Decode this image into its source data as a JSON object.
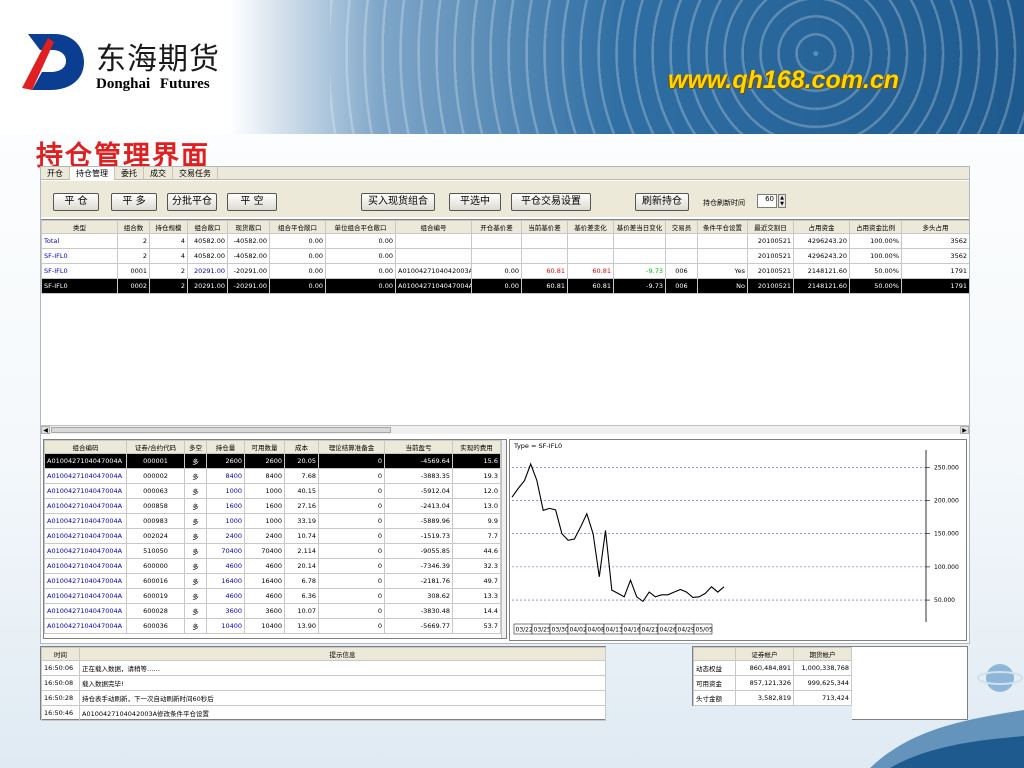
{
  "banner": {
    "brand_cn": "东海期货",
    "brand_en": "Donghai   Futures",
    "website": "www.qh168.com.cn"
  },
  "slide_title": "持仓管理界面",
  "tabs": [
    "开仓",
    "持仓管理",
    "委托",
    "成交",
    "交易任务"
  ],
  "toolbar": {
    "buttons": [
      "平 仓",
      "平 多",
      "分批平仓",
      "平 空",
      "买入现货组合",
      "平选中",
      "平仓交易设置",
      "刷新持仓"
    ],
    "refresh_label": "持仓刷新时间",
    "refresh_value": "60"
  },
  "positions": {
    "headers": [
      "类型",
      "组合数",
      "持仓规模",
      "组合敞口",
      "现货敞口",
      "组合平仓敞口",
      "单位组合平仓敞口",
      "组合编号",
      "开仓基价差",
      "当前基价差",
      "基价差变化",
      "基价差当日变化",
      "交易员",
      "条件平仓设置",
      "最近交割日",
      "占用资金",
      "占用资金比例",
      "多头占用"
    ],
    "rows": [
      [
        "Total",
        "2",
        "4",
        "40582.00",
        "-40582.00",
        "0.00",
        "0.00",
        "",
        "",
        "",
        "",
        "",
        "",
        "",
        "20100521",
        "4296243.20",
        "100.00%",
        "3562"
      ],
      [
        "SF-IFL0",
        "2",
        "4",
        "40582.00",
        "-40582.00",
        "0.00",
        "0.00",
        "",
        "",
        "",
        "",
        "",
        "",
        "",
        "20100521",
        "4296243.20",
        "100.00%",
        "3562"
      ],
      [
        "SF-IFL0",
        "0001",
        "2",
        "20291.00",
        "-20291.00",
        "0.00",
        "0.00",
        "A0100427104042003A",
        "0.00",
        "60.81",
        "60.81",
        "-9.73",
        "006",
        "Yes",
        "20100521",
        "2148121.60",
        "50.00%",
        "1791"
      ],
      [
        "SF-IFL0",
        "0002",
        "2",
        "20291.00",
        "-20291.00",
        "0.00",
        "0.00",
        "A0100427104047004A",
        "0.00",
        "60.81",
        "60.81",
        "-9.73",
        "006",
        "No",
        "20100521",
        "2148121.60",
        "50.00%",
        "1791"
      ]
    ]
  },
  "holdings": {
    "headers": [
      "组合编码",
      "证券/合约代码",
      "多空",
      "持仓量",
      "可用数量",
      "成本",
      "理论结算准备金",
      "当前盈亏",
      "实现的费用"
    ],
    "rows": [
      [
        "A0100427104047004A",
        "000001",
        "多",
        "2600",
        "2600",
        "20.05",
        "0",
        "-4569.64",
        "15.6"
      ],
      [
        "A0100427104047004A",
        "000002",
        "多",
        "8400",
        "8400",
        "7.68",
        "0",
        "-3883.35",
        "19.3"
      ],
      [
        "A0100427104047004A",
        "000063",
        "多",
        "1000",
        "1000",
        "40.15",
        "0",
        "-5912.04",
        "12.0"
      ],
      [
        "A0100427104047004A",
        "000858",
        "多",
        "1600",
        "1600",
        "27.16",
        "0",
        "-2413.04",
        "13.0"
      ],
      [
        "A0100427104047004A",
        "000983",
        "多",
        "1000",
        "1000",
        "33.19",
        "0",
        "-5889.96",
        "9.9"
      ],
      [
        "A0100427104047004A",
        "002024",
        "多",
        "2400",
        "2400",
        "10.74",
        "0",
        "-1519.73",
        "7.7"
      ],
      [
        "A0100427104047004A",
        "510050",
        "多",
        "70400",
        "70400",
        "2.114",
        "0",
        "-9055.85",
        "44.6"
      ],
      [
        "A0100427104047004A",
        "600000",
        "多",
        "4600",
        "4600",
        "20.14",
        "0",
        "-7346.39",
        "32.3"
      ],
      [
        "A0100427104047004A",
        "600016",
        "多",
        "16400",
        "16400",
        "6.78",
        "0",
        "-2181.76",
        "49.7"
      ],
      [
        "A0100427104047004A",
        "600019",
        "多",
        "4600",
        "4600",
        "6.36",
        "0",
        "308.62",
        "13.3"
      ],
      [
        "A0100427104047004A",
        "600028",
        "多",
        "3600",
        "3600",
        "10.07",
        "0",
        "-3830.48",
        "14.4"
      ],
      [
        "A0100427104047004A",
        "600036",
        "多",
        "10400",
        "10400",
        "13.90",
        "0",
        "-5669.77",
        "53.7"
      ]
    ]
  },
  "chart_data": {
    "type": "line",
    "title": "Type = SF-IFL0",
    "x_labels": [
      "03/22",
      "03/25",
      "03/30",
      "04/02",
      "04/08",
      "04/13",
      "04/16",
      "04/21",
      "04/26",
      "04/29",
      "05/05"
    ],
    "y_ticks": [
      50,
      100,
      150,
      200,
      250
    ],
    "y_tick_labels": [
      "50.000",
      "100.000",
      "150.000",
      "200.000",
      "250.000"
    ],
    "ylim": [
      20,
      270
    ],
    "values": [
      205,
      218,
      230,
      255,
      230,
      185,
      188,
      186,
      150,
      140,
      142,
      160,
      180,
      150,
      85,
      155,
      65,
      60,
      55,
      80,
      55,
      48,
      62,
      55,
      58,
      58,
      62,
      66,
      62,
      54,
      55,
      60,
      70,
      62,
      70
    ],
    "grid": true
  },
  "log": {
    "headers": [
      "时间",
      "提示信息"
    ],
    "rows": [
      [
        "16:50:06",
        "正在载入数据，请稍等……"
      ],
      [
        "16:50:08",
        "载入数据完毕!"
      ],
      [
        "16:50:28",
        "持仓表手动刷新，下一次自动刷新时间60秒后"
      ],
      [
        "16:50:46",
        "A0100427104042003A修改条件平仓设置"
      ]
    ]
  },
  "accounts": {
    "headers": [
      "",
      "证券帐户",
      "期货帐户"
    ],
    "rows": [
      [
        "动态权益",
        "860,484,891",
        "1,000,338,768"
      ],
      [
        "可用资金",
        "857,121,326",
        "999,625,344"
      ],
      [
        "头寸金额",
        "3,582,819",
        "713,424"
      ]
    ]
  }
}
